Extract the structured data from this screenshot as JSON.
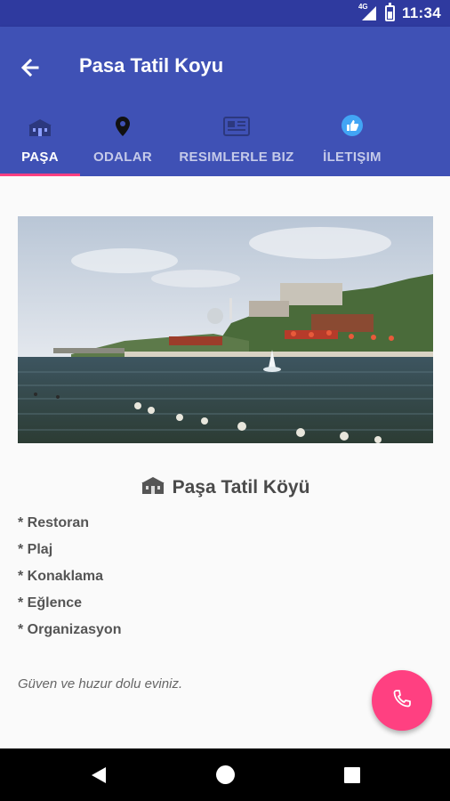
{
  "status_bar": {
    "network": "4G",
    "time": "11:34"
  },
  "app_bar": {
    "title": "Pasa Tatil Koyu",
    "back_icon": "arrow-back-icon"
  },
  "tabs": [
    {
      "label": "PAŞA",
      "icon": "villa-icon",
      "active": true
    },
    {
      "label": "ODALAR",
      "icon": "location-pin-icon",
      "active": false
    },
    {
      "label": "RESIMLERLE BIZ",
      "icon": "news-icon",
      "active": false
    },
    {
      "label": "İLETIŞIM",
      "icon": "thumbs-up-icon",
      "active": false
    }
  ],
  "content": {
    "heading": "Paşa Tatil Köyü",
    "features": [
      "* Restoran",
      "* Plaj",
      "* Konaklama",
      "* Eğlence",
      "* Organizasyon"
    ],
    "tagline": "Güven ve huzur dolu eviniz."
  },
  "fab": {
    "icon": "phone-icon"
  },
  "colors": {
    "primary": "#3f51b5",
    "primary_dark": "#2f3a9f",
    "accent": "#ff4081"
  }
}
